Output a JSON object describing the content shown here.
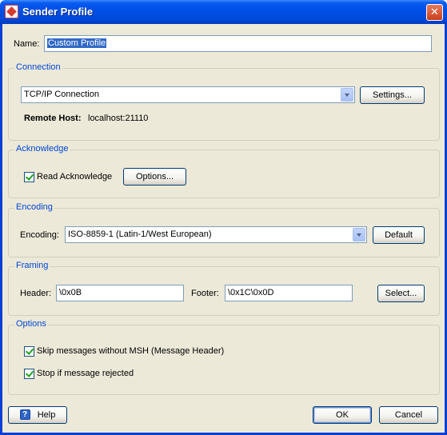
{
  "window": {
    "title": "Sender Profile",
    "close_glyph": "✕"
  },
  "name_field": {
    "label": "Name:",
    "value": "Custom Profile"
  },
  "connection": {
    "group_title": "Connection",
    "type_value": "TCP/IP Connection",
    "settings_label": "Settings...",
    "remote_host_label": "Remote Host:",
    "remote_host_value": "localhost:21110"
  },
  "acknowledge": {
    "group_title": "Acknowledge",
    "read_ack_label": "Read Acknowledge",
    "read_ack_checked": true,
    "options_label": "Options..."
  },
  "encoding": {
    "group_title": "Encoding",
    "label": "Encoding:",
    "value": "ISO-8859-1 (Latin-1/West European)",
    "default_label": "Default"
  },
  "framing": {
    "group_title": "Framing",
    "header_label": "Header:",
    "header_value": "\\0x0B",
    "footer_label": "Footer:",
    "footer_value": "\\0x1C\\0x0D",
    "select_label": "Select..."
  },
  "options": {
    "group_title": "Options",
    "skip_label": "Skip messages without MSH (Message Header)",
    "skip_checked": true,
    "stop_label": "Stop if message rejected",
    "stop_checked": true
  },
  "footer": {
    "help_label": "Help",
    "help_icon": "?",
    "ok_label": "OK",
    "cancel_label": "Cancel"
  },
  "colors": {
    "titlebar": "#0050e8",
    "group_title": "#0046d5",
    "dialog_bg": "#ece9d8"
  }
}
